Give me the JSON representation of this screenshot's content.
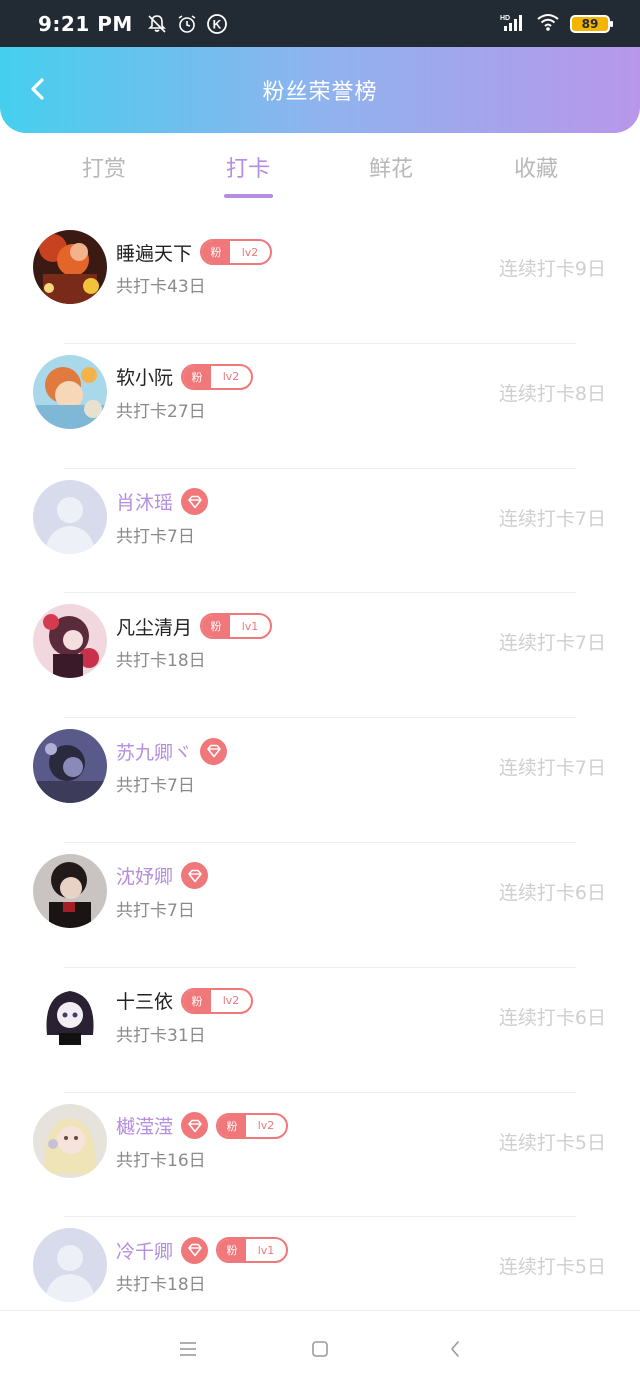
{
  "status": {
    "time": "9:21 PM",
    "battery": "89",
    "network": "HD"
  },
  "header": {
    "title": "粉丝荣誉榜"
  },
  "tabs": [
    {
      "label": "打赏",
      "active": false
    },
    {
      "label": "打卡",
      "active": true
    },
    {
      "label": "鲜花",
      "active": false
    },
    {
      "label": "收藏",
      "active": false
    }
  ],
  "badge_label": "粉",
  "rows": [
    {
      "name": "睡遍天下",
      "vip": false,
      "diamond": false,
      "fan_level": "lv2",
      "total": "共打卡43日",
      "streak": "连续打卡9日",
      "avatar": "anime-orange"
    },
    {
      "name": "软小阮",
      "vip": false,
      "diamond": false,
      "fan_level": "lv2",
      "total": "共打卡27日",
      "streak": "连续打卡8日",
      "avatar": "cartoon-blue"
    },
    {
      "name": "肖沐瑶",
      "vip": true,
      "diamond": true,
      "fan_level": "",
      "total": "共打卡7日",
      "streak": "连续打卡7日",
      "avatar": "default"
    },
    {
      "name": "凡尘清月",
      "vip": false,
      "diamond": false,
      "fan_level": "lv1",
      "total": "共打卡18日",
      "streak": "连续打卡7日",
      "avatar": "anime-pink"
    },
    {
      "name": "苏九卿ヾ",
      "vip": true,
      "diamond": true,
      "fan_level": "",
      "total": "共打卡7日",
      "streak": "连续打卡7日",
      "avatar": "dark-purple"
    },
    {
      "name": "沈妤卿",
      "vip": true,
      "diamond": true,
      "fan_level": "",
      "total": "共打卡7日",
      "streak": "连续打卡6日",
      "avatar": "dark-red"
    },
    {
      "name": "十三依",
      "vip": false,
      "diamond": false,
      "fan_level": "lv2",
      "total": "共打卡31日",
      "streak": "连续打卡6日",
      "avatar": "bw-girl"
    },
    {
      "name": "樾滢滢",
      "vip": true,
      "diamond": true,
      "fan_level": "lv2",
      "total": "共打卡16日",
      "streak": "连续打卡5日",
      "avatar": "blonde"
    },
    {
      "name": "冷千卿",
      "vip": true,
      "diamond": true,
      "fan_level": "lv1",
      "total": "共打卡18日",
      "streak": "连续打卡5日",
      "avatar": "default"
    }
  ],
  "colors": {
    "accent_purple": "#b48ee0",
    "badge_red": "#f0777a",
    "header_start": "#45cfee",
    "header_end": "#b897ea"
  }
}
